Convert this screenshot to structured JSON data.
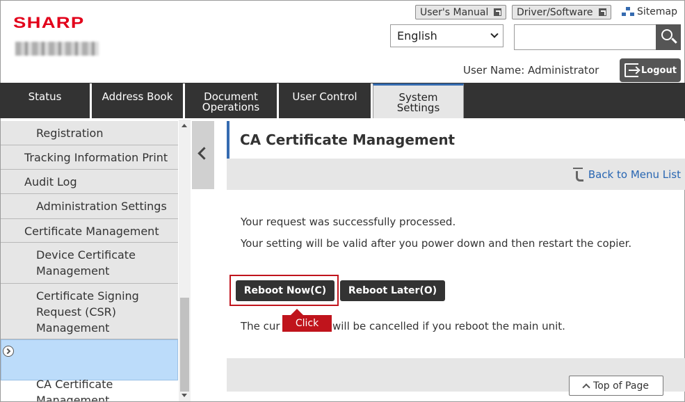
{
  "header": {
    "brand": "SHARP",
    "users_manual": "User's Manual",
    "driver_software": "Driver/Software",
    "sitemap": "Sitemap",
    "language": "English",
    "search_value": "",
    "user_name_text": "User Name: Administrator",
    "logout": "Logout"
  },
  "tabs": [
    {
      "label": "Status"
    },
    {
      "label": "Address Book"
    },
    {
      "label": "Document\nOperations"
    },
    {
      "label": "User Control"
    },
    {
      "label": "System\nSettings"
    }
  ],
  "sidebar": {
    "items": [
      {
        "label": "Registration"
      },
      {
        "label": "Tracking Information Print"
      },
      {
        "label": "Audit Log"
      },
      {
        "label": "Administration Settings"
      },
      {
        "label": "Certificate Management"
      },
      {
        "label": "Device Certificate\nManagement"
      },
      {
        "label": "Certificate Signing\nRequest (CSR)\nManagement"
      },
      {
        "label": "CA Certificate\nManagement"
      }
    ]
  },
  "main": {
    "title": "CA Certificate Management",
    "back_link": "Back to Menu List",
    "message1": "Your request was successfully processed.",
    "message2": "Your setting will be valid after you power down and then restart the copier.",
    "reboot_now": "Reboot Now(C)",
    "reboot_later": "Reboot Later(O)",
    "note_left": "The cur",
    "note_right": "will be cancelled if you reboot the main unit.",
    "callout": "Click",
    "top_of_page": "Top of Page"
  },
  "colors": {
    "brand_red": "#e2001a",
    "accent_blue": "#356bb0",
    "selected_bg": "#bcdcfa",
    "highlight_red": "#c0141c"
  }
}
